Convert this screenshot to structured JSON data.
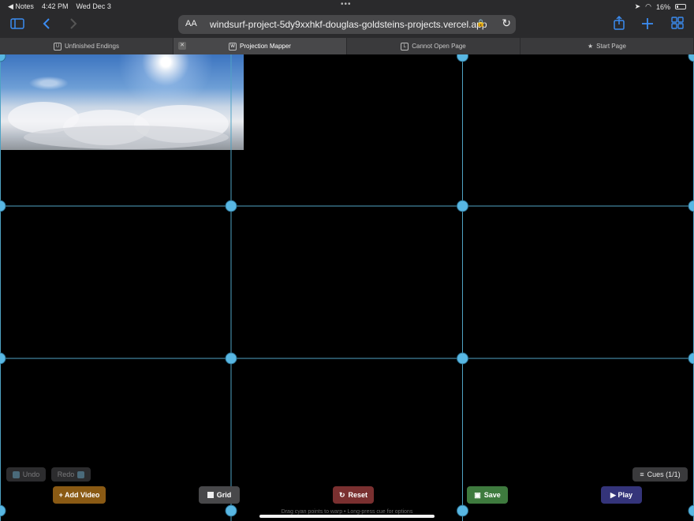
{
  "status": {
    "back_app": "◀ Notes",
    "time": "4:42 PM",
    "date": "Wed Dec 3",
    "dots": "•••",
    "battery": "16%"
  },
  "toolbar": {
    "aa": "AA",
    "url": "windsurf-project-5dy9xxhkf-douglas-goldsteins-projects.vercel.app"
  },
  "tabs": [
    {
      "favicon": "U",
      "label": "Unfinished Endings"
    },
    {
      "favicon": "W",
      "label": "Projection Mapper"
    },
    {
      "favicon": "L",
      "label": "Cannot Open Page"
    },
    {
      "favicon": "★",
      "label": "Start Page"
    }
  ],
  "controls": {
    "undo": "Undo",
    "redo": "Redo",
    "cues": "Cues (1/1)",
    "add_video": "+ Add Video",
    "grid": "Grid",
    "reset": "Reset",
    "save": "Save",
    "play": "▶ Play"
  },
  "hint": "Drag cyan points to warp • Long-press cue for options",
  "colors": {
    "grid_line": "#4fa3c4",
    "grid_point": "#58b7e3",
    "accent": "#3b8cf2"
  }
}
